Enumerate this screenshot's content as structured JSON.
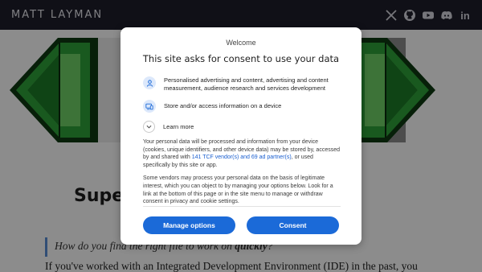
{
  "site": {
    "title": "MATT LAYMAN",
    "social_icons": [
      "x-icon",
      "github-icon",
      "youtube-icon",
      "discord-icon",
      "linkedin-icon"
    ],
    "linkedin_label": "in"
  },
  "article": {
    "heading_partial": "Super",
    "quote_prefix": "How do you find the right file to work on ",
    "quote_emphasis": "quickly",
    "quote_suffix": "?",
    "body_first_line": "If you've worked with an Integrated Development Environment (IDE) in the past, you"
  },
  "consent": {
    "welcome": "Welcome",
    "title": "This site asks for consent to use your data",
    "purposes": [
      {
        "icon": "person-icon",
        "text": "Personalised advertising and content, advertising and content measurement, audience research and services development"
      },
      {
        "icon": "device-icon",
        "text": "Store and/or access information on a device"
      }
    ],
    "learn_more": "Learn more",
    "para1_before_link": "Your personal data will be processed and information from your device (cookies, unique identifiers, and other device data) may be stored by, accessed by and shared with ",
    "para1_link": "141 TCF vendor(s) and 69 ad partner(s)",
    "para1_after_link": ", or used specifically by this site or app.",
    "para2": "Some vendors may process your personal data on the basis of legitimate interest, which you can object to by managing your options below. Look for a link at the bottom of this page or in the site menu to manage or withdraw consent in privacy and cookie settings.",
    "manage_label": "Manage options",
    "consent_label": "Consent"
  },
  "colors": {
    "topbar": "#1e1e2a",
    "button_blue": "#1b6ad8",
    "link_blue": "#1a5fd0",
    "icon_bg": "#dce8fb",
    "quote_bar": "#5a8fd6"
  }
}
